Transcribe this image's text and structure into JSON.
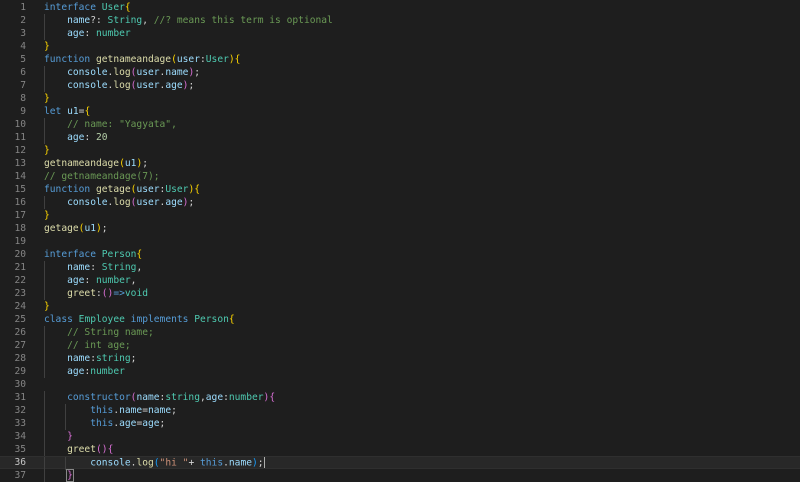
{
  "editor": {
    "current_line": 36,
    "lines": [
      {
        "n": "1",
        "tokens": [
          [
            "k",
            "interface"
          ],
          [
            "p",
            " "
          ],
          [
            "t",
            "User"
          ],
          [
            "b1",
            "{"
          ]
        ]
      },
      {
        "n": "2",
        "tokens": [
          [
            "p",
            "    "
          ],
          [
            "v",
            "name"
          ],
          [
            "p",
            "?: "
          ],
          [
            "t",
            "String"
          ],
          [
            "p",
            ", "
          ],
          [
            "c",
            "//? means this term is optional"
          ]
        ]
      },
      {
        "n": "3",
        "tokens": [
          [
            "p",
            "    "
          ],
          [
            "v",
            "age"
          ],
          [
            "p",
            ": "
          ],
          [
            "t",
            "number"
          ]
        ]
      },
      {
        "n": "4",
        "tokens": [
          [
            "b1",
            "}"
          ]
        ]
      },
      {
        "n": "5",
        "tokens": [
          [
            "k",
            "function"
          ],
          [
            "p",
            " "
          ],
          [
            "f",
            "getnameandage"
          ],
          [
            "b1",
            "("
          ],
          [
            "v",
            "user"
          ],
          [
            "p",
            ":"
          ],
          [
            "t",
            "User"
          ],
          [
            "b1",
            ")"
          ],
          [
            "b1",
            "{"
          ]
        ]
      },
      {
        "n": "6",
        "tokens": [
          [
            "p",
            "    "
          ],
          [
            "v",
            "console"
          ],
          [
            "p",
            "."
          ],
          [
            "f",
            "log"
          ],
          [
            "b2",
            "("
          ],
          [
            "v",
            "user"
          ],
          [
            "p",
            "."
          ],
          [
            "v",
            "name"
          ],
          [
            "b2",
            ")"
          ],
          [
            "p",
            ";"
          ]
        ]
      },
      {
        "n": "7",
        "tokens": [
          [
            "p",
            "    "
          ],
          [
            "v",
            "console"
          ],
          [
            "p",
            "."
          ],
          [
            "f",
            "log"
          ],
          [
            "b2",
            "("
          ],
          [
            "v",
            "user"
          ],
          [
            "p",
            "."
          ],
          [
            "v",
            "age"
          ],
          [
            "b2",
            ")"
          ],
          [
            "p",
            ";"
          ]
        ]
      },
      {
        "n": "8",
        "tokens": [
          [
            "b1",
            "}"
          ]
        ]
      },
      {
        "n": "9",
        "tokens": [
          [
            "k",
            "let"
          ],
          [
            "p",
            " "
          ],
          [
            "v",
            "u1"
          ],
          [
            "p",
            "="
          ],
          [
            "b1",
            "{"
          ]
        ]
      },
      {
        "n": "10",
        "tokens": [
          [
            "p",
            "    "
          ],
          [
            "c",
            "// name: \"Yagyata\","
          ]
        ]
      },
      {
        "n": "11",
        "tokens": [
          [
            "p",
            "    "
          ],
          [
            "v",
            "age"
          ],
          [
            "p",
            ": "
          ],
          [
            "n",
            "20"
          ]
        ]
      },
      {
        "n": "12",
        "tokens": [
          [
            "b1",
            "}"
          ]
        ]
      },
      {
        "n": "13",
        "tokens": [
          [
            "f",
            "getnameandage"
          ],
          [
            "b1",
            "("
          ],
          [
            "v",
            "u1"
          ],
          [
            "b1",
            ")"
          ],
          [
            "p",
            ";"
          ]
        ]
      },
      {
        "n": "14",
        "tokens": [
          [
            "c",
            "// getnameandage(7);"
          ]
        ]
      },
      {
        "n": "15",
        "tokens": [
          [
            "k",
            "function"
          ],
          [
            "p",
            " "
          ],
          [
            "f",
            "getage"
          ],
          [
            "b1",
            "("
          ],
          [
            "v",
            "user"
          ],
          [
            "p",
            ":"
          ],
          [
            "t",
            "User"
          ],
          [
            "b1",
            ")"
          ],
          [
            "b1",
            "{"
          ]
        ]
      },
      {
        "n": "16",
        "tokens": [
          [
            "p",
            "    "
          ],
          [
            "v",
            "console"
          ],
          [
            "p",
            "."
          ],
          [
            "f",
            "log"
          ],
          [
            "b2",
            "("
          ],
          [
            "v",
            "user"
          ],
          [
            "p",
            "."
          ],
          [
            "v",
            "age"
          ],
          [
            "b2",
            ")"
          ],
          [
            "p",
            ";"
          ]
        ]
      },
      {
        "n": "17",
        "tokens": [
          [
            "b1",
            "}"
          ]
        ]
      },
      {
        "n": "18",
        "tokens": [
          [
            "f",
            "getage"
          ],
          [
            "b1",
            "("
          ],
          [
            "v",
            "u1"
          ],
          [
            "b1",
            ")"
          ],
          [
            "p",
            ";"
          ]
        ]
      },
      {
        "n": "19",
        "tokens": []
      },
      {
        "n": "20",
        "tokens": [
          [
            "k",
            "interface"
          ],
          [
            "p",
            " "
          ],
          [
            "t",
            "Person"
          ],
          [
            "b1",
            "{"
          ]
        ]
      },
      {
        "n": "21",
        "tokens": [
          [
            "p",
            "    "
          ],
          [
            "v",
            "name"
          ],
          [
            "p",
            ": "
          ],
          [
            "t",
            "String"
          ],
          [
            "p",
            ","
          ]
        ]
      },
      {
        "n": "22",
        "tokens": [
          [
            "p",
            "    "
          ],
          [
            "v",
            "age"
          ],
          [
            "p",
            ": "
          ],
          [
            "t",
            "number"
          ],
          [
            "p",
            ","
          ]
        ]
      },
      {
        "n": "23",
        "tokens": [
          [
            "p",
            "    "
          ],
          [
            "f",
            "greet"
          ],
          [
            "p",
            ":"
          ],
          [
            "b2",
            "()"
          ],
          [
            "k",
            "=>"
          ],
          [
            "t",
            "void"
          ]
        ]
      },
      {
        "n": "24",
        "tokens": [
          [
            "b1",
            "}"
          ]
        ]
      },
      {
        "n": "25",
        "tokens": [
          [
            "k",
            "class"
          ],
          [
            "p",
            " "
          ],
          [
            "t",
            "Employee"
          ],
          [
            "p",
            " "
          ],
          [
            "k",
            "implements"
          ],
          [
            "p",
            " "
          ],
          [
            "t",
            "Person"
          ],
          [
            "b1",
            "{"
          ]
        ]
      },
      {
        "n": "26",
        "tokens": [
          [
            "p",
            "    "
          ],
          [
            "c",
            "// String name;"
          ]
        ]
      },
      {
        "n": "27",
        "tokens": [
          [
            "p",
            "    "
          ],
          [
            "c",
            "// int age;"
          ]
        ]
      },
      {
        "n": "28",
        "tokens": [
          [
            "p",
            "    "
          ],
          [
            "v",
            "name"
          ],
          [
            "p",
            ":"
          ],
          [
            "t",
            "string"
          ],
          [
            "p",
            ";"
          ]
        ]
      },
      {
        "n": "29",
        "tokens": [
          [
            "p",
            "    "
          ],
          [
            "v",
            "age"
          ],
          [
            "p",
            ":"
          ],
          [
            "t",
            "number"
          ]
        ]
      },
      {
        "n": "30",
        "tokens": []
      },
      {
        "n": "31",
        "tokens": [
          [
            "p",
            "    "
          ],
          [
            "k",
            "constructor"
          ],
          [
            "b2",
            "("
          ],
          [
            "v",
            "name"
          ],
          [
            "p",
            ":"
          ],
          [
            "t",
            "string"
          ],
          [
            "p",
            ","
          ],
          [
            "v",
            "age"
          ],
          [
            "p",
            ":"
          ],
          [
            "t",
            "number"
          ],
          [
            "b2",
            ")"
          ],
          [
            "b2",
            "{"
          ]
        ]
      },
      {
        "n": "32",
        "tokens": [
          [
            "p",
            "        "
          ],
          [
            "k",
            "this"
          ],
          [
            "p",
            "."
          ],
          [
            "v",
            "name"
          ],
          [
            "p",
            "="
          ],
          [
            "v",
            "name"
          ],
          [
            "p",
            ";"
          ]
        ]
      },
      {
        "n": "33",
        "tokens": [
          [
            "p",
            "        "
          ],
          [
            "k",
            "this"
          ],
          [
            "p",
            "."
          ],
          [
            "v",
            "age"
          ],
          [
            "p",
            "="
          ],
          [
            "v",
            "age"
          ],
          [
            "p",
            ";"
          ]
        ]
      },
      {
        "n": "34",
        "tokens": [
          [
            "p",
            "    "
          ],
          [
            "b2",
            "}"
          ]
        ]
      },
      {
        "n": "35",
        "tokens": [
          [
            "p",
            "    "
          ],
          [
            "f",
            "greet"
          ],
          [
            "b2",
            "()"
          ],
          [
            "b2",
            "{"
          ]
        ]
      },
      {
        "n": "36",
        "tokens": [
          [
            "p",
            "        "
          ],
          [
            "v",
            "console"
          ],
          [
            "p",
            "."
          ],
          [
            "f",
            "log"
          ],
          [
            "b3",
            "("
          ],
          [
            "s",
            "\"hi \""
          ],
          [
            "p",
            "+ "
          ],
          [
            "k",
            "this"
          ],
          [
            "p",
            "."
          ],
          [
            "v",
            "name"
          ],
          [
            "b3",
            ")"
          ],
          [
            "p",
            ";"
          ],
          [
            "cursor",
            ""
          ]
        ]
      },
      {
        "n": "37",
        "tokens": [
          [
            "p",
            "    "
          ],
          [
            "b2b",
            "}"
          ]
        ]
      }
    ]
  }
}
